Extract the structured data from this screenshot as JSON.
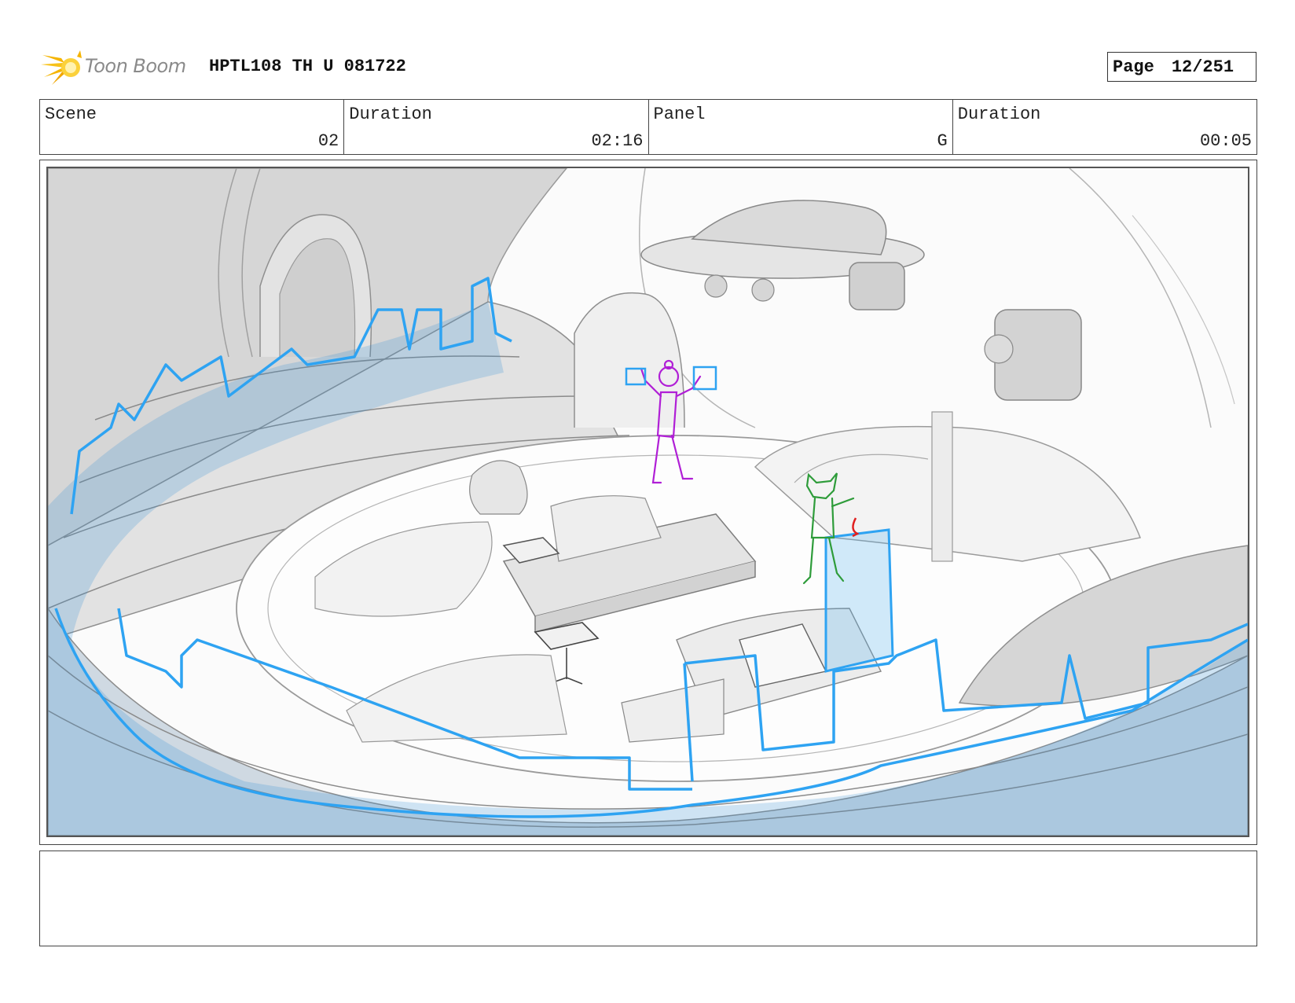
{
  "header": {
    "logo_text": "Toon Boom",
    "project_code": "HPTL108 TH U 081722",
    "page_label": "Page",
    "page_number": "12/251"
  },
  "info": {
    "scene_label": "Scene",
    "scene_value": "02",
    "scene_duration_label": "Duration",
    "scene_duration_value": "02:16",
    "panel_label": "Panel",
    "panel_value": "G",
    "panel_duration_label": "Duration",
    "panel_duration_value": "00:05"
  },
  "colors": {
    "water_stroke": "#2ea3f2",
    "water_fill": "#9cc7e6",
    "character_a": "#b01fd6",
    "character_b": "#2e9c3a",
    "motion_arrow": "#e02020",
    "sketch_line": "#8c8c8c",
    "wall_fill": "#d9d9d9"
  },
  "notes": {
    "text": ""
  }
}
